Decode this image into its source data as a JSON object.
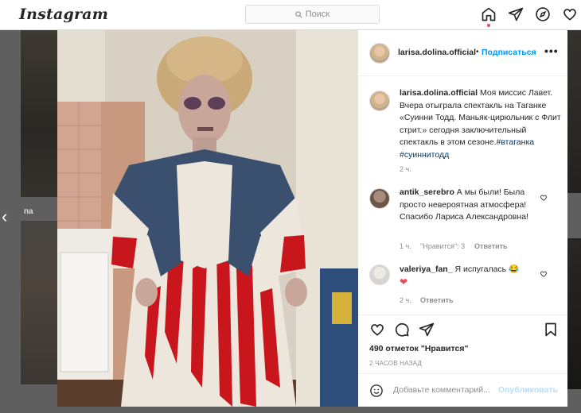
{
  "nav": {
    "logo": "Instagram",
    "search_placeholder": "Поиск",
    "icons": [
      "home-icon",
      "direct-icon",
      "explore-icon",
      "activity-icon"
    ]
  },
  "background": {
    "side_name": "па"
  },
  "post": {
    "username": "larisa.dolina.official",
    "follow_label": "Подписаться",
    "more_label": "•••",
    "caption_user": "larisa.dolina.official",
    "caption_text": " Моя миссис Лавет. Вчера отыграла спектакль на Таганке «Суинни Тодд. Маньяк-цирюльник с Флит стрит.» сегодня заключительный спектакль в этом сезоне.",
    "tags": [
      "#втаганка",
      "#суиннитодд"
    ],
    "caption_time": "2 ч.",
    "comments": [
      {
        "user": "antik_serebro",
        "text": " А мы были! Была просто невероятная атмосфера! Спасибо Лариса Александровна!",
        "time": "1 ч.",
        "likes": "\"Нравится\": 3",
        "reply": "Ответить"
      },
      {
        "user": "valeriya_fan_",
        "text": " Я испугалась 😂",
        "extra": "❤",
        "time": "2 ч.",
        "reply": "Ответить"
      }
    ],
    "likes_count": "490 отметок \"Нравится\"",
    "posted_ago": "2 ЧАСОВ НАЗАД",
    "comment_placeholder": "Добавьте комментарий...",
    "publish_label": "Опубликовать"
  },
  "colors": {
    "accent": "#0095f6",
    "link": "#00376b",
    "muted": "#8e8e8e",
    "heart": "#ed4956"
  }
}
